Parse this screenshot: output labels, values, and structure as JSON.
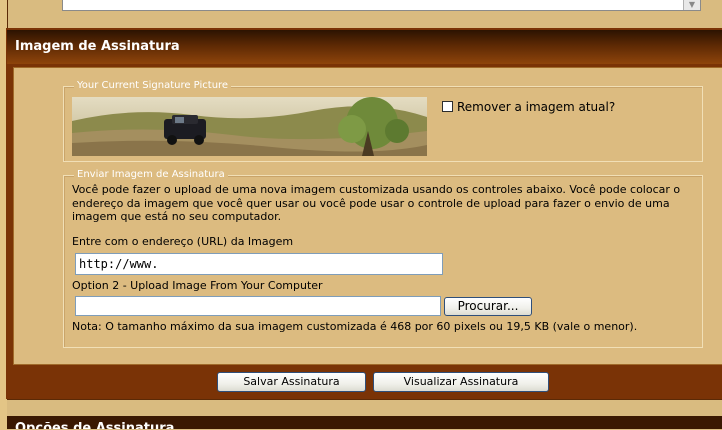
{
  "top_field": {
    "value": ""
  },
  "section": {
    "title": "Imagem de Assinatura"
  },
  "current_picture": {
    "legend": "Your Current Signature Picture",
    "remove_label": "Remover a imagem atual?",
    "remove_checked": false
  },
  "upload": {
    "legend": "Enviar Imagem de Assinatura",
    "description": "Você pode fazer o upload de uma nova imagem customizada usando os controles abaixo. Você pode colocar o endereço da imagem que você quer usar ou você pode usar o controle de upload para fazer o envio de uma imagem que está no seu computador.",
    "url_label": "Entre com o endereço (URL) da Imagem",
    "url_value": "http://www.",
    "file_label": "Option 2 - Upload Image From Your Computer",
    "file_value": "",
    "browse_label": "Procurar...",
    "note": "Nota: O tamanho máximo da sua imagem customizada é 468 por 60 pixels ou 19,5 KB (vale o menor)."
  },
  "actions": {
    "save_label": "Salvar Assinatura",
    "preview_label": "Visualizar Assinatura"
  },
  "next_section": {
    "title": "Opções de Assinatura"
  }
}
